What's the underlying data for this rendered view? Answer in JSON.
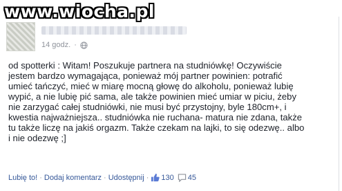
{
  "watermark": "www.wiocha.pl",
  "post": {
    "timestamp": "14 godz.",
    "body_lines": [
      "od spotterki : Witam! Poszukuje partnera na studniówkę! Oczywiście",
      "jestem bardzo wymagająca, ponieważ mój partner powinien: potrafić",
      "umieć tańczyć, mieć w miarę mocną głowę do alkoholu, ponieważ lubię",
      "wypić, a nie lubię pić sama, ale także powinien mieć umiar w piciu, żeby",
      "nie zarzygać całej studniówki, nie musi być przystojny, byle 180cm+, i",
      "kwestia najważniejsza.. studniówka nie ruchana- matura nie zdana, także",
      "tu także liczę na jakiś orgazm. Także czekam na lajki, to się odezwę.. albo",
      "i nie odezwę ;]"
    ],
    "actions": {
      "like": "Lubię to!",
      "comment": "Dodaj komentarz",
      "share": "Udostępnij",
      "separator": "·",
      "likes_count": "130",
      "comments_count": "45"
    },
    "icons": {
      "privacy": "globe-icon",
      "likes": "thumbs-up-icon",
      "comments": "comment-icon"
    },
    "colors": {
      "link": "#365899",
      "meta": "#90949c",
      "text": "#1d2129"
    }
  }
}
